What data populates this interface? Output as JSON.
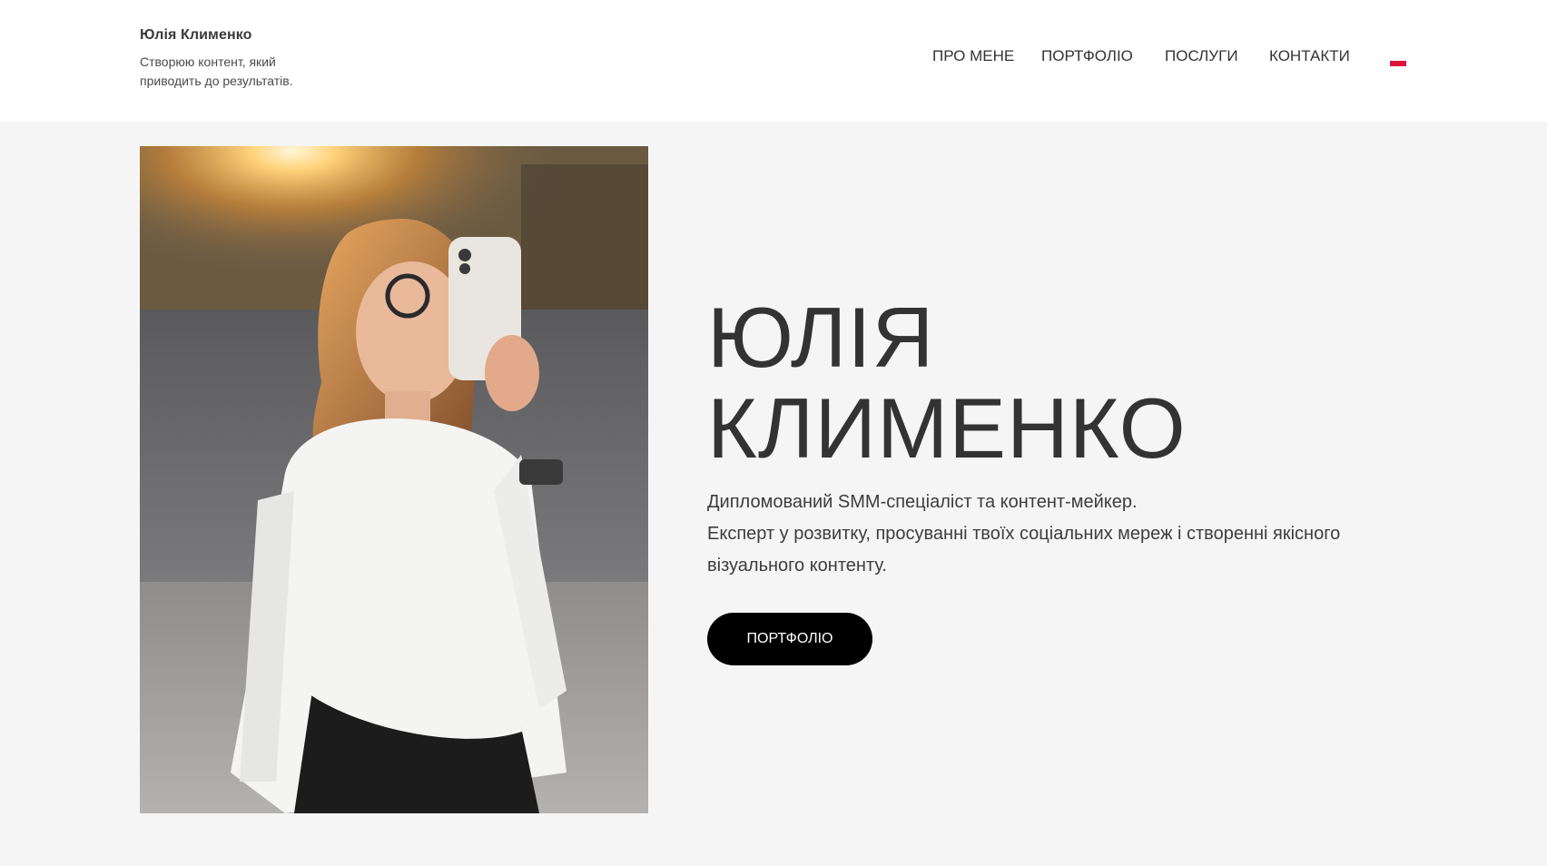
{
  "header": {
    "brand_name": "Юлія Клименко",
    "tagline": "Створюю контент, який приводить до результатів."
  },
  "nav": {
    "items": [
      {
        "label": "ПРО МЕНЕ"
      },
      {
        "label": "ПОРТФОЛІО"
      },
      {
        "label": "ПОСЛУГИ"
      },
      {
        "label": "КОНТАКТИ"
      }
    ],
    "language_flag": "flag-pl-icon"
  },
  "hero": {
    "title_line1": "ЮЛІЯ",
    "title_line2": "КЛИМЕНКО",
    "description_line1": "Дипломований SMM-спеціаліст та контент-мейкер.",
    "description_line2": "Експерт у розвитку, просуванні твоїх соціальних мереж і створенні якісного візуального контенту.",
    "button_label": "ПОРТФОЛІО"
  },
  "colors": {
    "header_bg": "#ffffff",
    "page_bg": "#f5f5f5",
    "text": "#333333",
    "button_bg": "#000000",
    "button_text": "#ffffff",
    "flag_red": "#dc143c"
  }
}
